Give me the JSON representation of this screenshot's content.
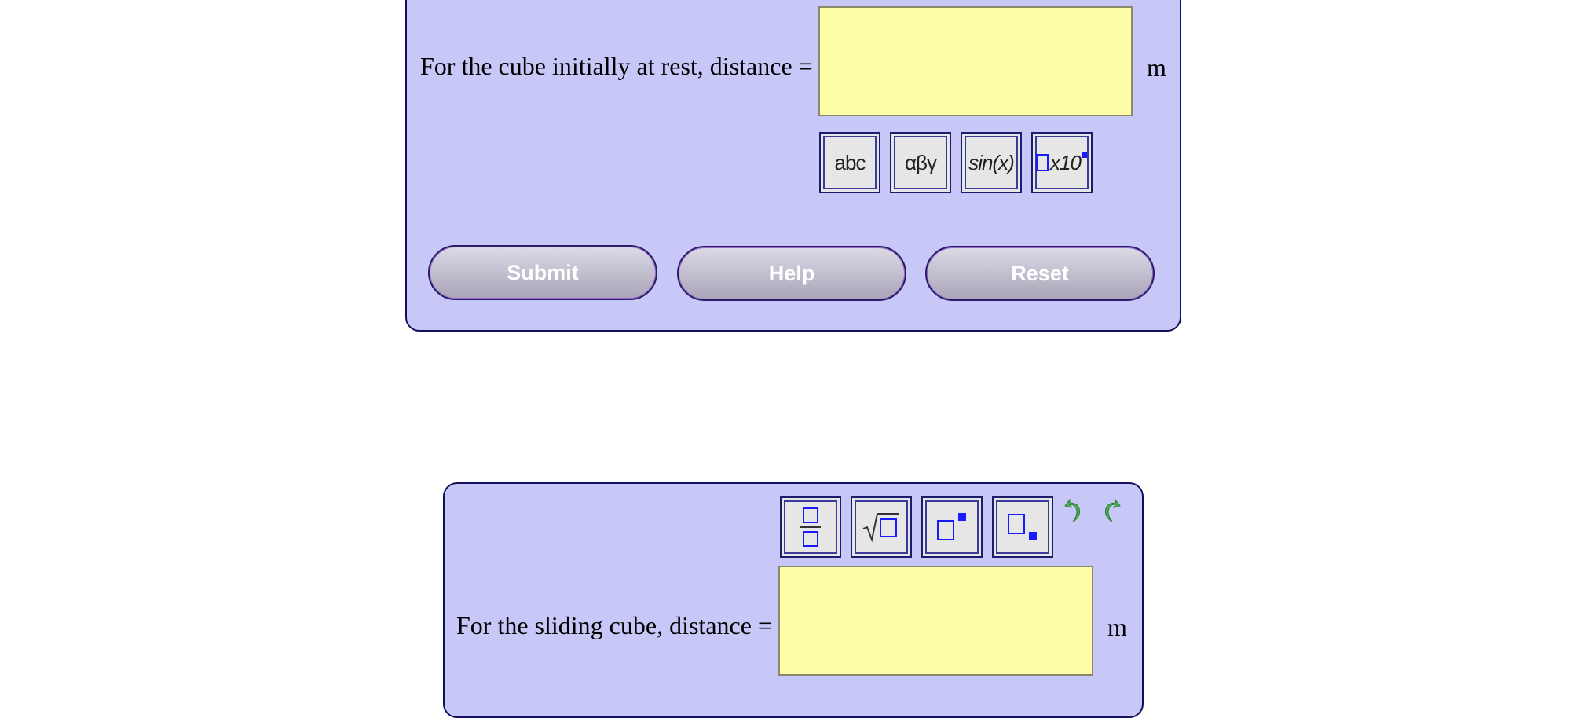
{
  "panel1": {
    "prompt": "For the cube initially at rest, distance =",
    "unit": "m",
    "answer_value": "",
    "palette": [
      {
        "label": "abc",
        "icon": "abc-text-icon"
      },
      {
        "label": "αβγ",
        "icon": "greek-letters-icon"
      },
      {
        "label": "sin(x)",
        "icon": "function-icon"
      },
      {
        "label": "x10",
        "icon": "scientific-notation-icon"
      }
    ],
    "buttons": {
      "submit": "Submit",
      "help": "Help",
      "reset": "Reset"
    }
  },
  "panel2": {
    "prompt": "For the sliding cube, distance =",
    "unit": "m",
    "answer_value": "",
    "toolbar": [
      {
        "icon": "fraction-icon"
      },
      {
        "icon": "square-root-icon"
      },
      {
        "icon": "superscript-icon"
      },
      {
        "icon": "subscript-icon"
      }
    ],
    "undo_icon": "undo-icon",
    "redo_icon": "redo-icon"
  },
  "colors": {
    "panel_bg": "#c8c8f8",
    "panel_border": "#0f0f5c",
    "answer_bg": "#fdfda8",
    "button_text": "#ffffff",
    "icon_blue": "#1a1aff",
    "undo_green": "#4caf50"
  }
}
